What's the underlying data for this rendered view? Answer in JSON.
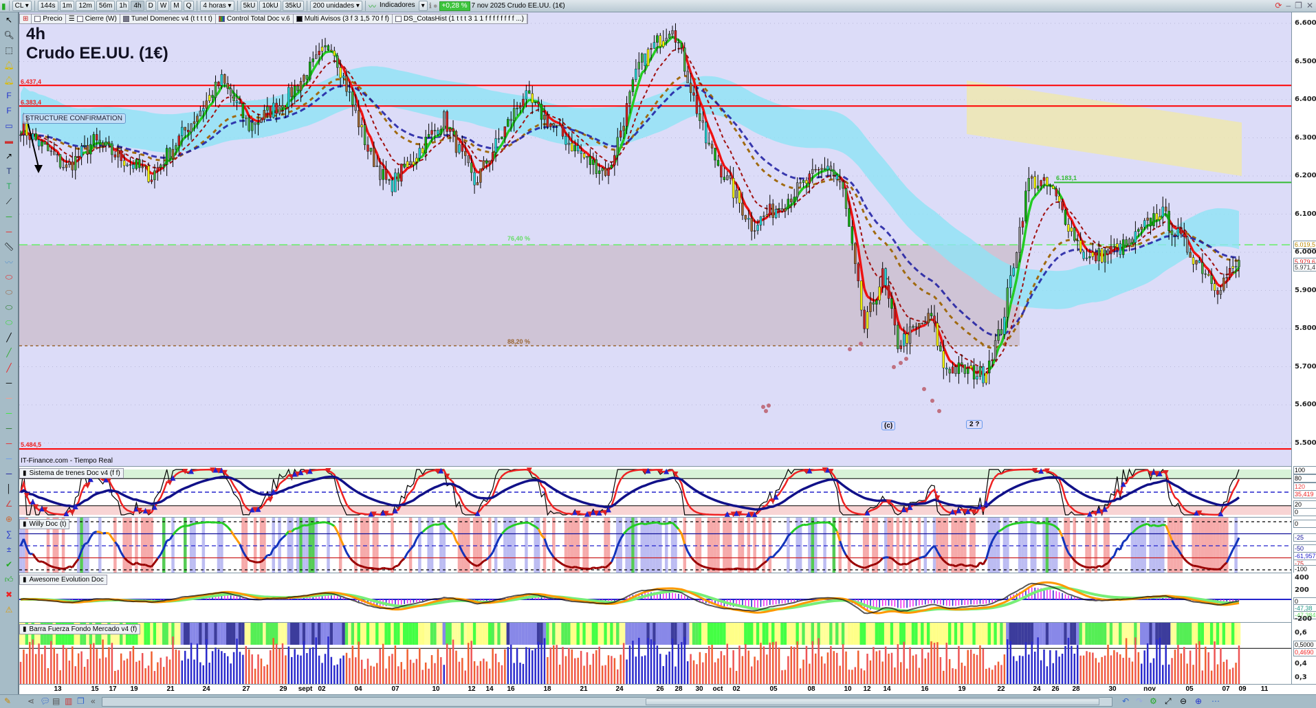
{
  "toolbar": {
    "symbol": "CL",
    "timeframes": [
      "144s",
      "1m",
      "12m",
      "56m",
      "1h",
      "4h",
      "D",
      "W",
      "M",
      "Q"
    ],
    "active_timeframe": "4h",
    "period": "4 horas",
    "units": [
      "5kU",
      "10kU",
      "35kU"
    ],
    "bars": "200 unidades",
    "indicators": "Indicadores",
    "change": "+0,28 %",
    "date_instrument": "7 nov 2025 Crudo EE.UU. (1€)"
  },
  "legend": {
    "items": [
      "Precio",
      "Cierre (W)",
      "Tunel Domenec v4 (t t t t t)",
      "Control Total Doc v.6",
      "Multi Avisos (3 f 3 1,5 70 f f)",
      "DS_CotasHist (1 t t t 3 1 1 f f f f f f f f ...)"
    ]
  },
  "chart": {
    "timeframe_title": "4h",
    "instrument_title": "Crudo EE.UU. (1€)",
    "level_labels": {
      "r1": "6.437,4",
      "r2": "6.383,4",
      "r3": "5.484,5",
      "g1": "6.183,1"
    },
    "fib_labels": {
      "f1": "76,40 %",
      "f2": "88,20 %"
    },
    "annotation": "STRUCTURE CONFIRMATION",
    "wave_labels": [
      "(c)",
      "2 ?"
    ],
    "source": "IT-Finance.com - Tiempo Real",
    "price_ticks": [
      "6.600",
      "6.500",
      "6.400",
      "6.300",
      "6.200",
      "6.100",
      "6.000",
      "5.900",
      "5.800",
      "5.700",
      "5.600",
      "5.500"
    ],
    "price_tags": {
      "a": "6.019,5",
      "b": "5.979,6",
      "c": "5.971,4"
    },
    "colors": {
      "bg": "#dcdcf8",
      "red": "#ff0000",
      "green": "#33aa33",
      "band": "#8fe3f5",
      "zone": "#eee8b0",
      "fib": "#cfc4d6"
    }
  },
  "chart_data": {
    "type": "line",
    "title": "Crudo EE.UU. (1€) 4h",
    "ylim": [
      5.45,
      6.62
    ],
    "keypoints_bar": [
      0,
      15,
      24,
      43,
      66,
      75,
      87,
      102,
      114,
      121,
      139,
      149,
      165,
      186,
      193,
      203,
      214,
      219,
      225,
      240,
      247,
      265,
      270,
      277,
      283,
      288,
      299,
      303,
      316,
      322,
      331,
      338,
      350,
      364,
      374,
      382,
      393,
      400
    ],
    "keypoints_price": [
      6.33,
      6.22,
      6.29,
      6.2,
      6.45,
      6.33,
      6.4,
      6.55,
      6.27,
      6.17,
      6.35,
      6.18,
      6.41,
      6.24,
      6.21,
      6.49,
      6.6,
      6.46,
      6.29,
      6.07,
      6.11,
      6.23,
      6.16,
      5.8,
      5.94,
      5.76,
      5.83,
      5.7,
      5.68,
      5.8,
      6.19,
      6.17,
      5.98,
      6.02,
      6.11,
      6.02,
      5.91,
      5.97
    ],
    "levels": [
      6.4374,
      6.3834,
      5.4845,
      6.1831,
      6.0195,
      5.755
    ]
  },
  "panels": {
    "sistema": {
      "title": "Sistema de trenes Doc v4 (f f)",
      "ticks": [
        "100",
        "80",
        "20",
        "0"
      ],
      "tag": "35,419",
      "tag2": "120"
    },
    "willy": {
      "title": "Willy Doc (t)",
      "ticks": [
        "0",
        "-25",
        "-50",
        "-75",
        "-100"
      ],
      "tag": "-61,957"
    },
    "awesome": {
      "title": "Awesome Evolution Doc",
      "ticks": [
        "400",
        "200",
        "0",
        "-200"
      ],
      "tag": "-47,384",
      "tag2": "-47,38"
    },
    "barra": {
      "title": "Barra Fuerza Fondo Mercado v4 (f)",
      "ticks": [
        "0,6",
        "0,4",
        "0,3"
      ],
      "tag": "0,5000",
      "tag2": "0,4690"
    }
  },
  "dates": [
    "13",
    "15",
    "17",
    "19",
    "21",
    "24",
    "27",
    "29",
    "sept",
    "02",
    "04",
    "07",
    "10",
    "12",
    "14",
    "16",
    "18",
    "21",
    "24",
    "26",
    "28",
    "30",
    "oct",
    "02",
    "05",
    "08",
    "10",
    "12",
    "14",
    "16",
    "19",
    "22",
    "24",
    "26",
    "28",
    "30",
    "nov",
    "05",
    "07",
    "09",
    "11"
  ]
}
